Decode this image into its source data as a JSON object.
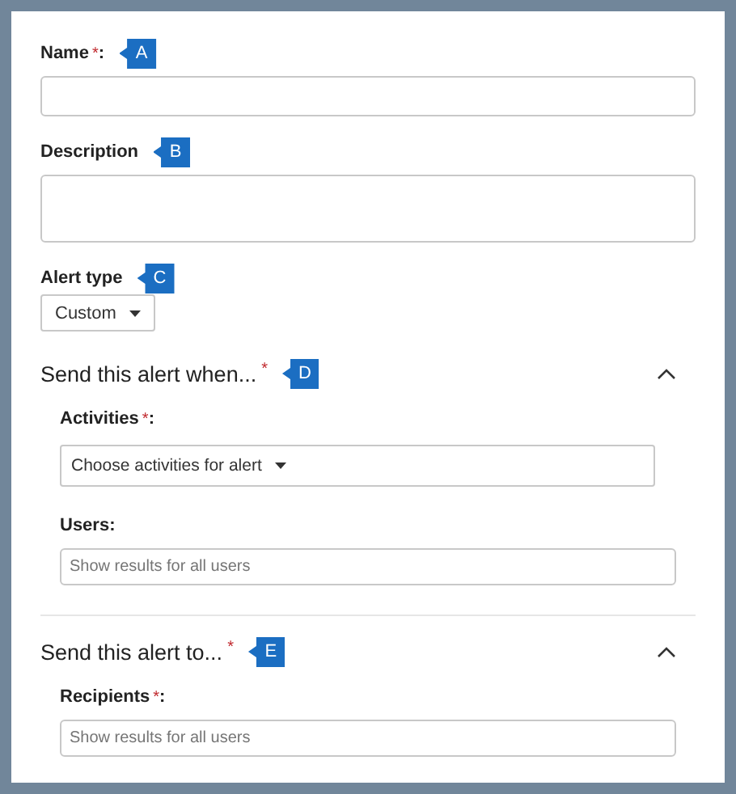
{
  "fields": [
    {
      "kind": "text",
      "label": "Name",
      "mark": "*",
      "suffix": ":",
      "callout": "A"
    },
    {
      "kind": "textarea",
      "label": "Description",
      "callout": "B"
    },
    {
      "kind": "dropdown",
      "label": "Alert type",
      "value": "Custom",
      "callout": "C"
    }
  ],
  "sections": [
    {
      "title": "Send this alert when...",
      "mark": "*",
      "callout": "D",
      "expanded": true,
      "fields": [
        {
          "kind": "dropdown",
          "label": "Activities",
          "mark": "*",
          "suffix": ":",
          "placeholder": "Choose activities for alert"
        },
        {
          "kind": "text",
          "label": "Users:",
          "placeholder": "Show results for all users"
        }
      ]
    },
    {
      "title": "Send this alert to...",
      "mark": "*",
      "callout": "E",
      "expanded": true,
      "fields": [
        {
          "kind": "text",
          "label": "Recipients",
          "mark": "*",
          "suffix": ":",
          "placeholder": "Show results for all users"
        }
      ]
    }
  ]
}
